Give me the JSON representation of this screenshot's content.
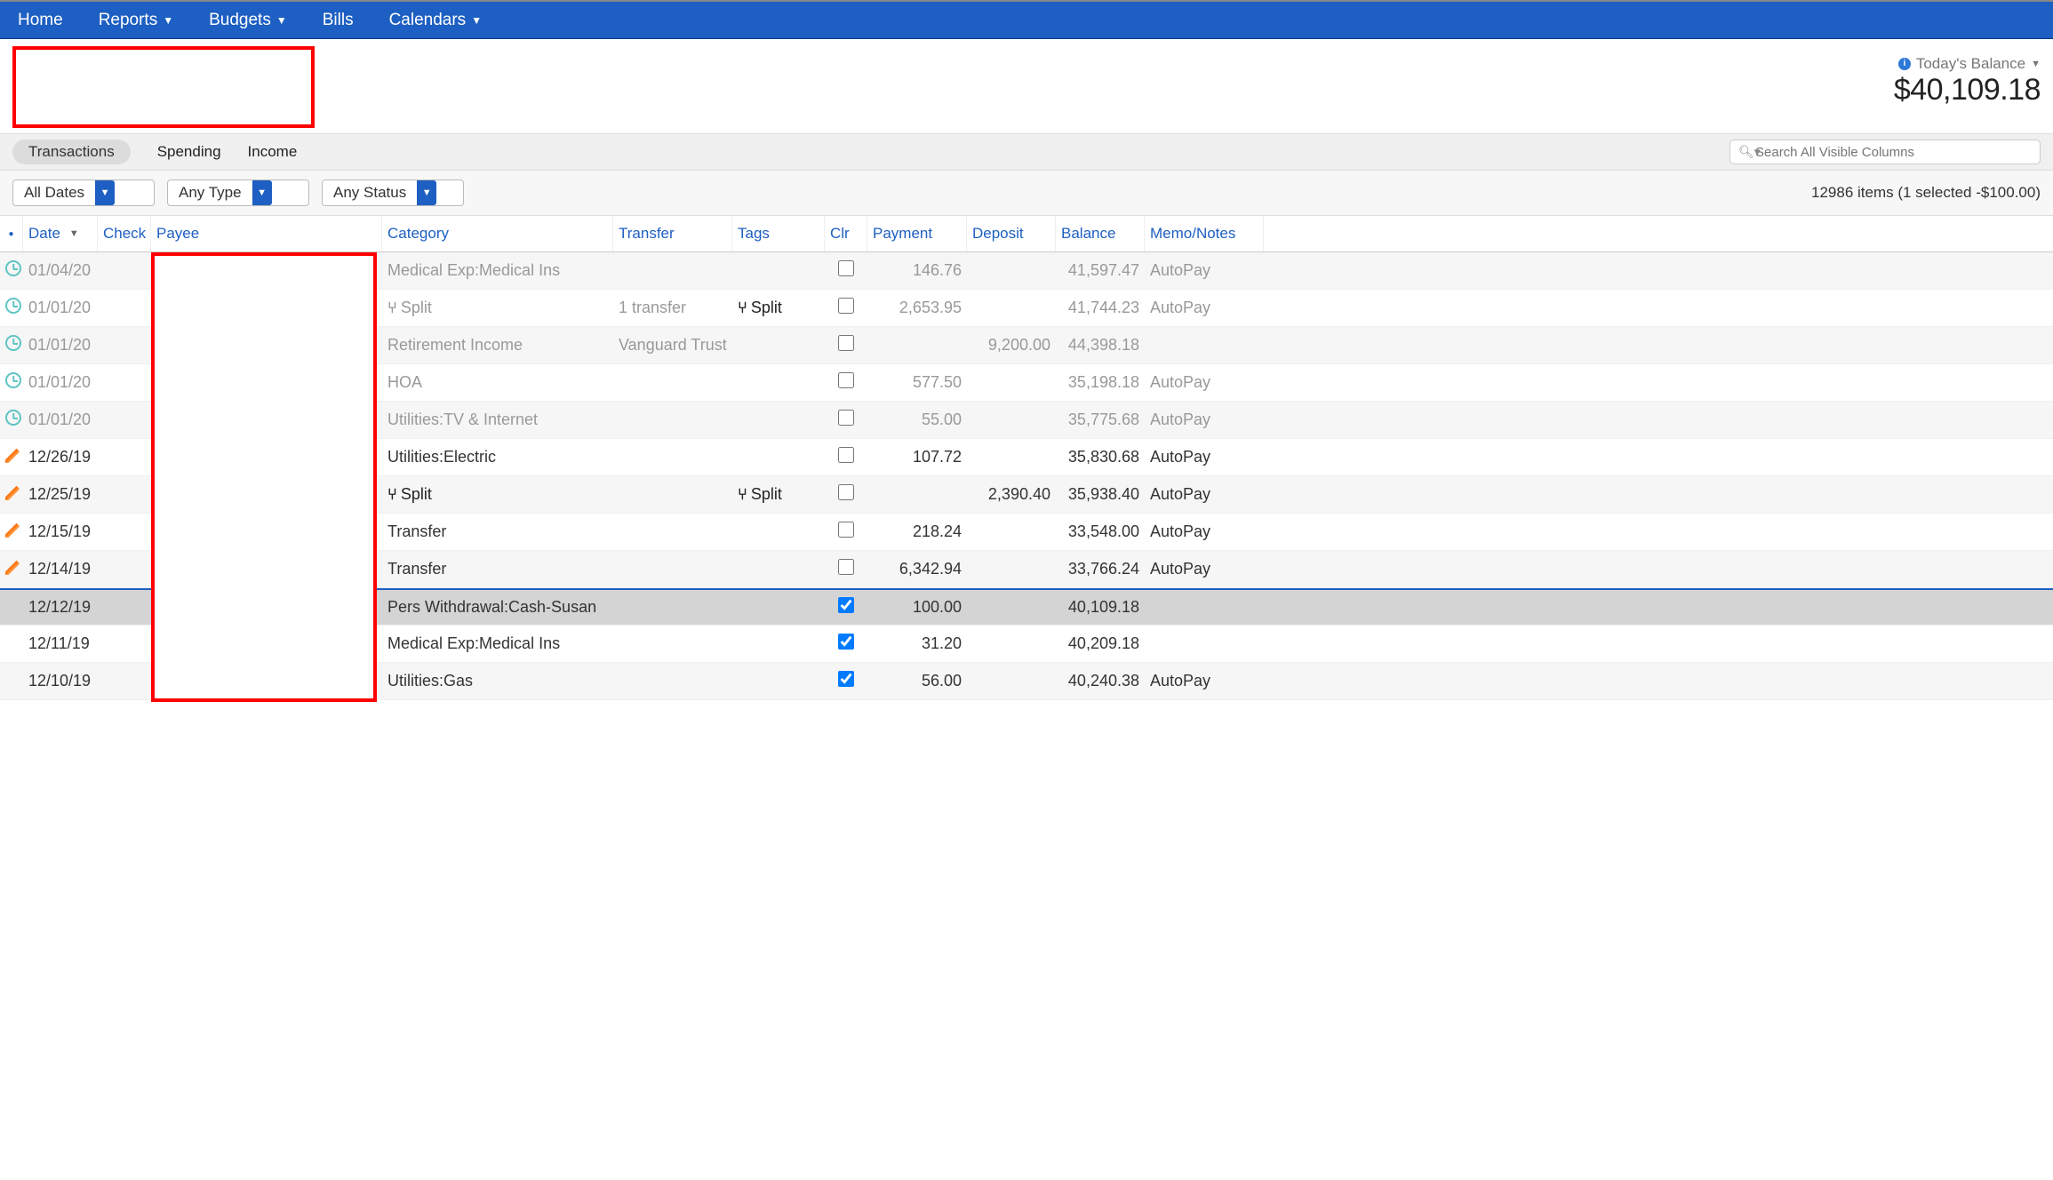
{
  "nav": {
    "home": "Home",
    "reports": "Reports",
    "budgets": "Budgets",
    "bills": "Bills",
    "calendars": "Calendars"
  },
  "header": {
    "balance_label": "Today's Balance",
    "balance_amount": "$40,109.18"
  },
  "tabs": {
    "transactions": "Transactions",
    "spending": "Spending",
    "income": "Income"
  },
  "search": {
    "placeholder": "Search All Visible Columns"
  },
  "filters": {
    "dates": "All Dates",
    "type": "Any Type",
    "status": "Any Status",
    "summary": "12986 items (1 selected -$100.00)"
  },
  "columns": {
    "date": "Date",
    "check": "Check",
    "payee": "Payee",
    "category": "Category",
    "transfer": "Transfer",
    "tags": "Tags",
    "clr": "Clr",
    "payment": "Payment",
    "deposit": "Deposit",
    "balance": "Balance",
    "memo": "Memo/Notes"
  },
  "rows": [
    {
      "icon": "clock",
      "date": "01/04/20",
      "category": "Medical Exp:Medical Ins",
      "transfer": "",
      "tags": "",
      "clr": false,
      "payment": "146.76",
      "deposit": "",
      "balance": "41,597.47",
      "memo": "AutoPay",
      "future": true,
      "alt": true
    },
    {
      "icon": "clock",
      "date": "01/01/20",
      "category_split": true,
      "category": "Split",
      "transfer": "1 transfer",
      "tags_split": true,
      "tags": "Split",
      "clr": false,
      "payment": "2,653.95",
      "deposit": "",
      "balance": "41,744.23",
      "memo": "AutoPay",
      "future": true,
      "alt": false
    },
    {
      "icon": "clock",
      "date": "01/01/20",
      "category": "Retirement Income",
      "transfer": "Vanguard Trust",
      "tags": "",
      "clr": false,
      "payment": "",
      "deposit": "9,200.00",
      "balance": "44,398.18",
      "memo": "",
      "future": true,
      "alt": true
    },
    {
      "icon": "clock",
      "date": "01/01/20",
      "category": "HOA",
      "transfer": "",
      "tags": "",
      "clr": false,
      "payment": "577.50",
      "deposit": "",
      "balance": "35,198.18",
      "memo": "AutoPay",
      "future": true,
      "alt": false
    },
    {
      "icon": "clock",
      "date": "01/01/20",
      "category": "Utilities:TV & Internet",
      "transfer": "",
      "tags": "",
      "clr": false,
      "payment": "55.00",
      "deposit": "",
      "balance": "35,775.68",
      "memo": "AutoPay",
      "future": true,
      "alt": true
    },
    {
      "icon": "pencil",
      "date": "12/26/19",
      "category": "Utilities:Electric",
      "transfer": "",
      "tags": "",
      "clr": false,
      "payment": "107.72",
      "deposit": "",
      "balance": "35,830.68",
      "memo": "AutoPay",
      "future": false,
      "alt": false
    },
    {
      "icon": "pencil",
      "date": "12/25/19",
      "category_split": true,
      "category": "Split",
      "transfer": "",
      "tags_split": true,
      "tags": "Split",
      "clr": false,
      "payment": "",
      "deposit": "2,390.40",
      "balance": "35,938.40",
      "memo": "AutoPay",
      "future": false,
      "alt": true
    },
    {
      "icon": "pencil",
      "date": "12/15/19",
      "category": "Transfer",
      "transfer": "",
      "tags": "",
      "clr": false,
      "payment": "218.24",
      "deposit": "",
      "balance": "33,548.00",
      "memo": "AutoPay",
      "future": false,
      "alt": false
    },
    {
      "icon": "pencil",
      "date": "12/14/19",
      "category": "Transfer",
      "transfer": "",
      "tags": "",
      "clr": false,
      "payment": "6,342.94",
      "deposit": "",
      "balance": "33,766.24",
      "memo": "AutoPay",
      "future": false,
      "alt": true
    },
    {
      "icon": "",
      "date": "12/12/19",
      "category": "Pers Withdrawal:Cash-Susan",
      "transfer": "",
      "tags": "",
      "clr": true,
      "payment": "100.00",
      "deposit": "",
      "balance": "40,109.18",
      "memo": "",
      "future": false,
      "alt": false,
      "selected": true,
      "divider": true
    },
    {
      "icon": "",
      "date": "12/11/19",
      "category": "Medical Exp:Medical Ins",
      "transfer": "",
      "tags": "",
      "clr": true,
      "payment": "31.20",
      "deposit": "",
      "balance": "40,209.18",
      "memo": "",
      "future": false,
      "alt": false
    },
    {
      "icon": "",
      "date": "12/10/19",
      "category": "Utilities:Gas",
      "transfer": "",
      "tags": "",
      "clr": true,
      "payment": "56.00",
      "deposit": "",
      "balance": "40,240.38",
      "memo": "AutoPay",
      "future": false,
      "alt": true
    }
  ]
}
